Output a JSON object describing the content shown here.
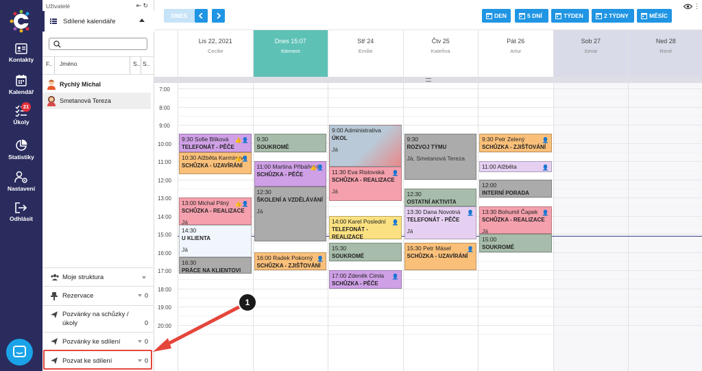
{
  "nav": {
    "items": [
      {
        "label": "Kontakty",
        "icon": "contacts-icon"
      },
      {
        "label": "Kalendář",
        "icon": "calendar-icon"
      },
      {
        "label": "Úkoly",
        "icon": "tasks-icon",
        "badge": "21"
      },
      {
        "label": "Statistiky",
        "icon": "pie-chart-icon"
      },
      {
        "label": "Nastavení",
        "icon": "settings-users-icon"
      },
      {
        "label": "Odhlásit",
        "icon": "logout-icon"
      }
    ]
  },
  "sidebar": {
    "users_label": "Uživatelé",
    "shared_calendars": "Sdílené kalendáře",
    "search_placeholder": "",
    "columns": {
      "f": "F..",
      "name": "Jméno",
      "s1": "S..",
      "s2": "S.."
    },
    "users": [
      {
        "name": "Rychlý Michal",
        "bold": true
      },
      {
        "name": "Smetanová Tereza",
        "bold": false
      }
    ],
    "sections": [
      {
        "label": "Moje struktura",
        "icon": "group-icon"
      },
      {
        "label": "Rezervace",
        "icon": "pin-icon",
        "count": "0"
      },
      {
        "label": "Pozvánky na schůzky / úkoly",
        "icon": "send-icon",
        "count": "0"
      },
      {
        "label": "Pozvánky ke sdílení",
        "icon": "send-icon",
        "count": "0"
      },
      {
        "label": "Pozvat ke sdílení",
        "icon": "send-icon",
        "count": "0"
      }
    ]
  },
  "toolbar": {
    "today": "DNES",
    "views": [
      "DEN",
      "5 DNÍ",
      "TÝDEN",
      "2 TÝDNY",
      "MĚSÍC"
    ]
  },
  "days": [
    {
      "date": "Lis 22, 2021",
      "person": "Cecilie"
    },
    {
      "date": "Dnes 15:07",
      "person": "Klement",
      "today": true
    },
    {
      "date": "Stř 24",
      "person": "Emílie"
    },
    {
      "date": "Čtv 25",
      "person": "Kateřina"
    },
    {
      "date": "Pát 26",
      "person": "Artur"
    },
    {
      "date": "Sob 27",
      "person": "Xenie",
      "weekend": true
    },
    {
      "date": "Ned 28",
      "person": "René",
      "weekend": true
    }
  ],
  "hours": [
    "7:00",
    "8:00",
    "9:00",
    "10:00",
    "11:00",
    "12:00",
    "13:00",
    "14:00",
    "15:00",
    "16:00",
    "17:00",
    "18:00",
    "19:00",
    "20:00"
  ],
  "events": [
    {
      "day": 0,
      "start": 9.5,
      "end": 10.5,
      "title": "9:30 Sofie Blíková",
      "type": "TELEFONÁT - PĚČE",
      "who": "",
      "color": "c-purple",
      "icons": "👍👤"
    },
    {
      "day": 0,
      "start": 10.5,
      "end": 11.7,
      "title": "10:30 Alžběta Karmínová",
      "type": "SCHŮZKA - UZAVÍRÁNÍ",
      "who": "",
      "color": "c-orange",
      "icons": "👍👤"
    },
    {
      "day": 0,
      "start": 13.0,
      "end": 14.5,
      "title": "13:00 Michal Pilný",
      "type": "SCHŮZKA - REALIZACE",
      "who": "Já",
      "color": "c-pink",
      "icons": "👍👤"
    },
    {
      "day": 0,
      "start": 14.5,
      "end": 16.3,
      "title": "14:30",
      "type": "U KLIENTA",
      "who": "Já",
      "color": "c-blue",
      "icons": ""
    },
    {
      "day": 0,
      "start": 16.3,
      "end": 17.2,
      "title": "16:30",
      "type": "PRÁCE NA KLIENTOVI",
      "who": "",
      "color": "c-gray",
      "icons": ""
    },
    {
      "day": 1,
      "start": 9.5,
      "end": 10.5,
      "title": "9:30",
      "type": "SOUKROMÉ",
      "who": "",
      "color": "c-green",
      "icons": ""
    },
    {
      "day": 1,
      "start": 11.0,
      "end": 12.4,
      "title": "11:00 Martina Přibáňová",
      "type": "SCHŮZKA - PĚČE",
      "who": "",
      "color": "c-purple",
      "icons": "👍👤"
    },
    {
      "day": 1,
      "start": 12.4,
      "end": 15.4,
      "title": "12:30",
      "type": "ŠKOLENÍ A VZDĚLÁVÁNÍ",
      "who": "Já",
      "color": "c-gray",
      "icons": ""
    },
    {
      "day": 1,
      "start": 16.0,
      "end": 17.0,
      "title": "16:00 Radek Pokorný",
      "type": "SCHŮZKA - ZJIŠŤOVÁNÍ",
      "who": "",
      "color": "c-orange",
      "icons": "👤"
    },
    {
      "day": 2,
      "start": 9.0,
      "end": 11.3,
      "title": "9:00 Administrativa",
      "type": "ÚKOL",
      "who": "Já",
      "color": "c-grad",
      "icons": ""
    },
    {
      "day": 2,
      "start": 11.3,
      "end": 13.2,
      "title": "11:30 Eva Ristovská",
      "type": "SCHŮZKA - REALIZACE",
      "who": "Já",
      "color": "c-pink",
      "icons": "👤"
    },
    {
      "day": 2,
      "start": 14.0,
      "end": 15.3,
      "title": "14:00 Karel Poslední",
      "type": "TELEFONÁT - REALIZACE",
      "who": "",
      "color": "c-yellow",
      "icons": "👤"
    },
    {
      "day": 2,
      "start": 15.5,
      "end": 16.5,
      "title": "15:30",
      "type": "SOUKROMÉ",
      "who": "",
      "color": "c-green",
      "icons": ""
    },
    {
      "day": 2,
      "start": 17.0,
      "end": 18.0,
      "title": "17:00 Zdeněk Cimla",
      "type": "SCHŮZKA - PĚČE",
      "who": "",
      "color": "c-purple",
      "icons": "👤"
    },
    {
      "day": 3,
      "start": 9.5,
      "end": 12.0,
      "title": "9:30",
      "type": "ROZVOJ TÝMU",
      "who": "Já, Smetanová Tereza",
      "color": "c-gray",
      "icons": ""
    },
    {
      "day": 3,
      "start": 12.5,
      "end": 13.5,
      "title": "12:30",
      "type": "OSTATNÍ AKTIVITA",
      "who": "",
      "color": "c-green",
      "icons": ""
    },
    {
      "day": 3,
      "start": 13.5,
      "end": 15.3,
      "title": "13:30 Dana Novotná",
      "type": "TELEFONÁT - PĚČE",
      "who": "Já",
      "color": "c-lav",
      "icons": "👤"
    },
    {
      "day": 3,
      "start": 15.5,
      "end": 17.0,
      "title": "15:30 Petr Másel",
      "type": "SCHŮZKA - UZAVÍRÁNÍ",
      "who": "",
      "color": "c-orange",
      "icons": "👤"
    },
    {
      "day": 4,
      "start": 9.5,
      "end": 10.5,
      "title": "9:30 Petr Zelený",
      "type": "SCHŮZKA - ZJIŠŤOVÁNÍ",
      "who": "",
      "color": "c-orange",
      "icons": "👤"
    },
    {
      "day": 4,
      "start": 11.0,
      "end": 11.6,
      "title": "11:00 Alžběta",
      "type": "",
      "who": "",
      "color": "c-lav",
      "icons": "👤"
    },
    {
      "day": 4,
      "start": 12.0,
      "end": 13.0,
      "title": "12:00",
      "type": "INTERNÍ PORADA",
      "who": "",
      "color": "c-gray",
      "icons": ""
    },
    {
      "day": 4,
      "start": 13.5,
      "end": 15.0,
      "title": "13:30 Bohumil Čapek",
      "type": "SCHŮZKA - REALIZACE",
      "who": "Já",
      "color": "c-pink",
      "icons": "👤"
    },
    {
      "day": 4,
      "start": 15.0,
      "end": 16.0,
      "title": "15:00",
      "type": "SOUKROMÉ",
      "who": "",
      "color": "c-green",
      "icons": ""
    }
  ],
  "annotation": {
    "marker": "1"
  },
  "colors": {
    "nav_bg": "#2a2c5e",
    "accent": "#2095e4",
    "today": "#5ec1b6",
    "highlight": "#e5463b"
  }
}
